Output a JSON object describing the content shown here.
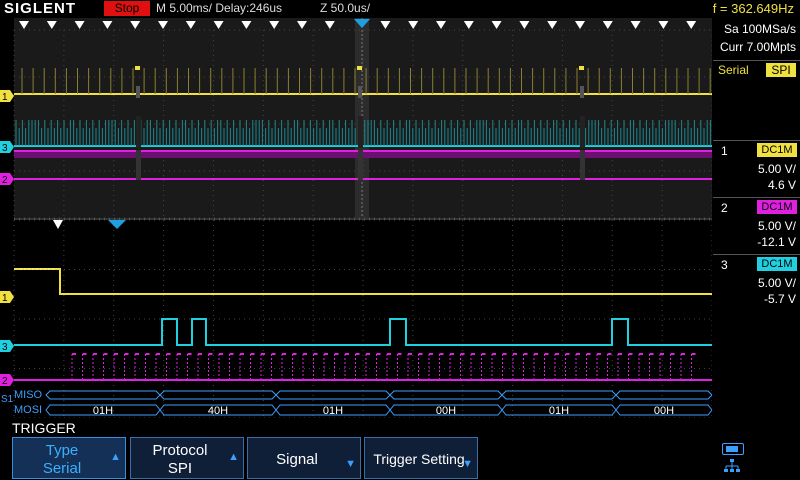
{
  "header": {
    "brand": "SIGLENT",
    "run_state": "Stop",
    "timebase": "M 5.00ms/ Delay:246us",
    "zoom": "Z 50.0us/",
    "frequency": "f = 362.649Hz"
  },
  "acquisition": {
    "sample_rate": "Sa 100MSa/s",
    "memory": "Curr 7.00Mpts"
  },
  "trigger_info": {
    "type": "Serial",
    "protocol": "SPI"
  },
  "channels": [
    {
      "id": "1",
      "coupling": "DC1M",
      "scale": "5.00 V/",
      "offset": "4.6 V",
      "color": "#f0e040"
    },
    {
      "id": "2",
      "coupling": "DC1M",
      "scale": "5.00 V/",
      "offset": "-12.1 V",
      "color": "#e020e0"
    },
    {
      "id": "3",
      "coupling": "DC1M",
      "scale": "5.00 V/",
      "offset": "-5.7 V",
      "color": "#20d0e0"
    }
  ],
  "marker_labels": {
    "ch1": "1",
    "ch2": "2",
    "ch3": "3",
    "decode": "S1"
  },
  "decode": {
    "miso_label": "MISO",
    "mosi_label": "MOSI",
    "mosi_values": [
      "01H",
      "40H",
      "01H",
      "00H",
      "01H",
      "00H"
    ]
  },
  "menu": {
    "title": "TRIGGER",
    "softkeys": [
      {
        "line1": "Type",
        "line2": "Serial"
      },
      {
        "line1": "Protocol",
        "line2": "SPI"
      },
      {
        "line1": "Signal",
        "line2": ""
      },
      {
        "line1": "Trigger Setting",
        "line2": ""
      }
    ]
  },
  "colors": {
    "ch1": "#f0e040",
    "ch2": "#e020e0",
    "ch3": "#20d0e0",
    "decode_bus": "#3aa0ff",
    "trigger_marker": "#1ea0e0",
    "stop_badge": "#e01010"
  },
  "icons": [
    "usb-icon",
    "network-icon",
    "trigger-position-marker-icon"
  ]
}
